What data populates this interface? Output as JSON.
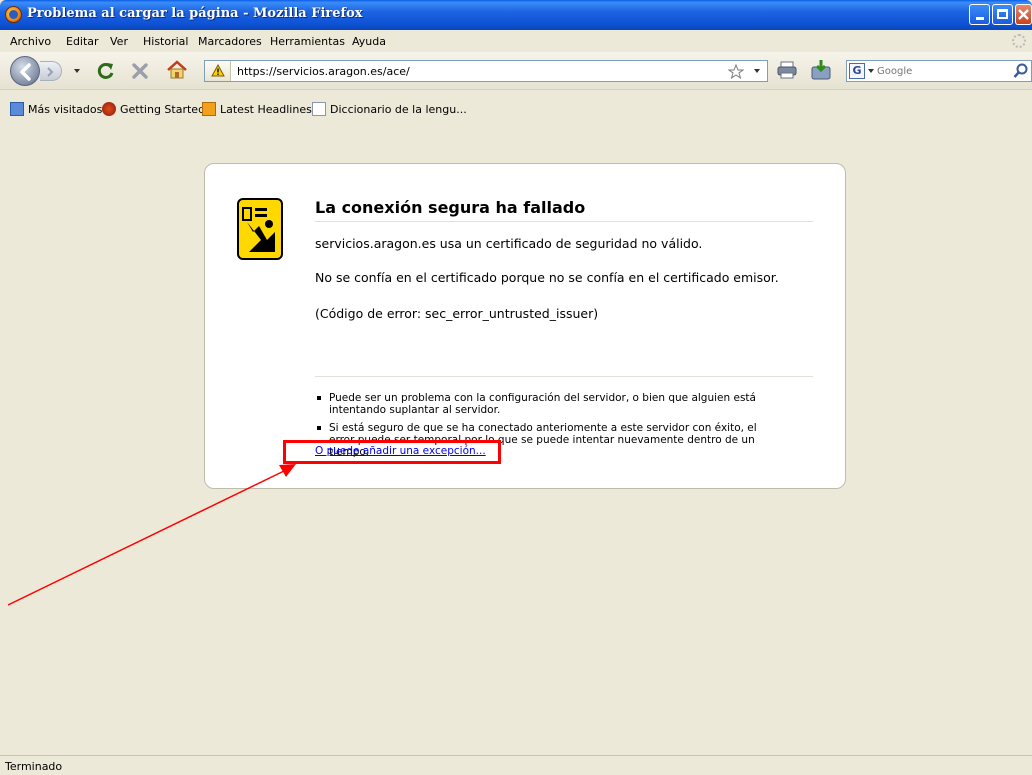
{
  "window": {
    "title": "Problema al cargar la página - Mozilla Firefox"
  },
  "menu": [
    "Archivo",
    "Editar",
    "Ver",
    "Historial",
    "Marcadores",
    "Herramientas",
    "Ayuda"
  ],
  "navbar": {
    "url": "https://servicios.aragon.es/ace/",
    "search_placeholder": "Google"
  },
  "bookmarks": [
    {
      "label": "Más visitados",
      "icon": "most-visited-icon"
    },
    {
      "label": "Getting Started",
      "icon": "firefox-getting-started-icon"
    },
    {
      "label": "Latest Headlines",
      "icon": "rss-feed-icon"
    },
    {
      "label": "Diccionario de la lengu...",
      "icon": "page-icon"
    }
  ],
  "error": {
    "title": "La conexión segura ha fallado",
    "p1": "servicios.aragon.es usa un certificado de seguridad no válido.",
    "p2": "No se confía en el certificado porque no se confía en el certificado emisor.",
    "p3": "(Código de error: sec_error_untrusted_issuer)",
    "bullets": [
      "Puede ser un problema con la configuración del servidor, o bien que alguien está intentando suplantar al servidor.",
      "Si está seguro de que se ha conectado anteriomente a este servidor con éxito, el error puede ser temporal por lo que se puede intentar nuevamente dentro de un tiempo."
    ],
    "exception_link": "O puede añadir una excepción..."
  },
  "annotation": {
    "highlight_color": "#ff0000"
  },
  "status": {
    "text": "Terminado"
  }
}
